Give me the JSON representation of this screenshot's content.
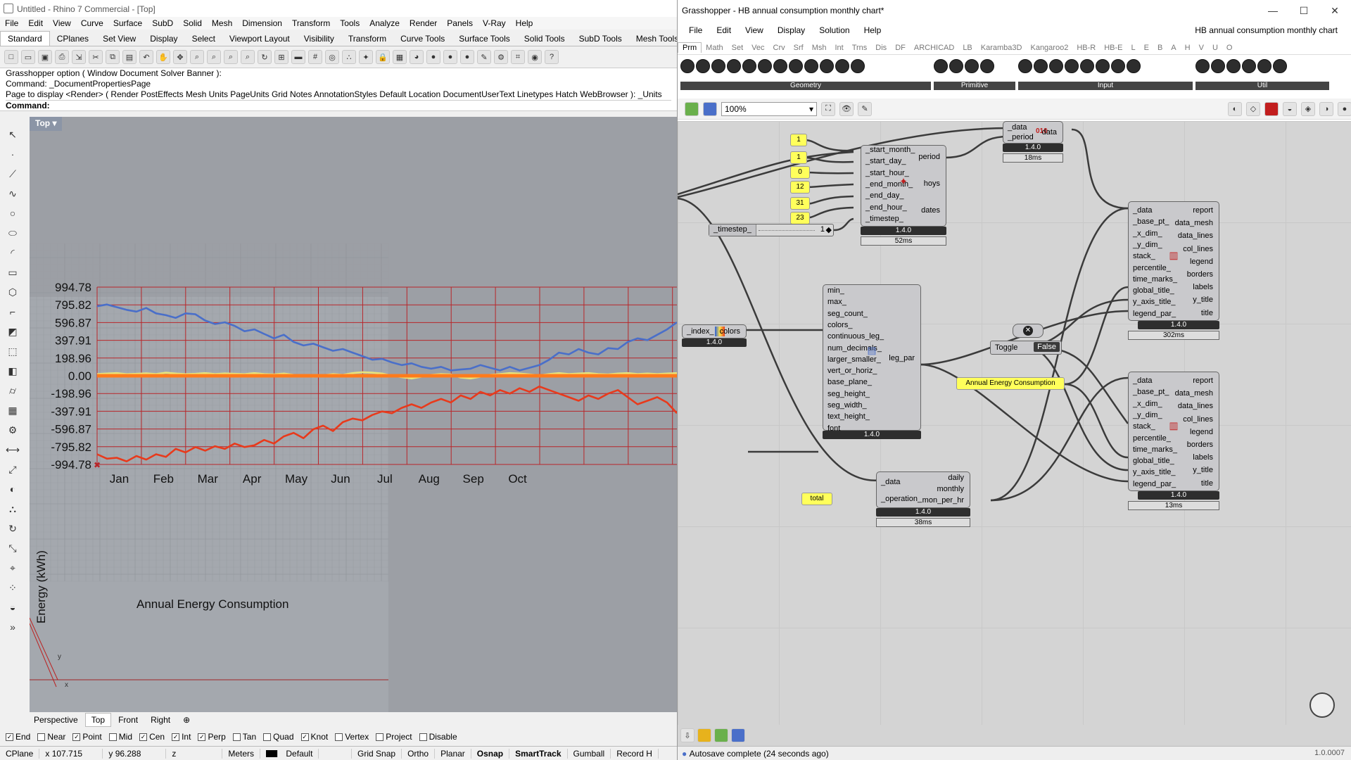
{
  "rhino": {
    "title": "Untitled - Rhino 7 Commercial - [Top]",
    "menu": [
      "File",
      "Edit",
      "View",
      "Curve",
      "Surface",
      "SubD",
      "Solid",
      "Mesh",
      "Dimension",
      "Transform",
      "Tools",
      "Analyze",
      "Render",
      "Panels",
      "V-Ray",
      "Help"
    ],
    "tabs": [
      "Standard",
      "CPlanes",
      "Set View",
      "Display",
      "Select",
      "Viewport Layout",
      "Visibility",
      "Transform",
      "Curve Tools",
      "Surface Tools",
      "Solid Tools",
      "SubD Tools",
      "Mesh Tools"
    ],
    "command_lines": [
      "Grasshopper option ( Window  Document  Solver  Banner ):",
      "Command: _DocumentPropertiesPage",
      "Page to display <Render> ( Render  PostEffects  Mesh  Units  PageUnits  Grid  Notes  AnnotationStyles  Default  Location  DocumentUserText  Linetypes  Hatch  WebBrowser ): _Units"
    ],
    "command_prompt": "Command:",
    "viewport_name": "Top",
    "view_tabs": [
      "Perspective",
      "Top",
      "Front",
      "Right"
    ],
    "osnaps": [
      {
        "label": "End",
        "checked": true
      },
      {
        "label": "Near",
        "checked": false
      },
      {
        "label": "Point",
        "checked": true
      },
      {
        "label": "Mid",
        "checked": false
      },
      {
        "label": "Cen",
        "checked": true
      },
      {
        "label": "Int",
        "checked": true
      },
      {
        "label": "Perp",
        "checked": true
      },
      {
        "label": "Tan",
        "checked": false
      },
      {
        "label": "Quad",
        "checked": false
      },
      {
        "label": "Knot",
        "checked": true
      },
      {
        "label": "Vertex",
        "checked": false
      },
      {
        "label": "Project",
        "checked": false
      },
      {
        "label": "Disable",
        "checked": false
      }
    ],
    "status": {
      "cplane": "CPlane",
      "x": "x 107.715",
      "y": "y 96.288",
      "z": "z",
      "units": "Meters",
      "layer": "Default",
      "toggles": [
        "Grid Snap",
        "Ortho",
        "Planar",
        "Osnap",
        "SmartTrack",
        "Gumball",
        "Record H"
      ]
    }
  },
  "chart_data": {
    "type": "line",
    "title": "Annual Energy Consumption",
    "ylabel": "Energy (kWh)",
    "xlabel": "",
    "categories": [
      "Jan",
      "Feb",
      "Mar",
      "Apr",
      "May",
      "Jun",
      "Jul",
      "Aug",
      "Sep",
      "Oct"
    ],
    "y_ticks": [
      "994.78",
      "795.82",
      "596.87",
      "397.91",
      "198.96",
      "0.00",
      "-198.96",
      "-397.91",
      "-596.87",
      "-795.82",
      "-994.78"
    ],
    "ylim": [
      -994.78,
      994.78
    ],
    "grid": true,
    "series": [
      {
        "color": "#4a6fc9",
        "values": [
          780,
          800,
          770,
          740,
          720,
          760,
          700,
          680,
          650,
          700,
          690,
          620,
          580,
          600,
          560,
          500,
          520,
          470,
          420,
          460,
          380,
          340,
          360,
          320,
          280,
          300,
          260,
          220,
          180,
          190,
          150,
          120,
          140,
          100,
          80,
          100,
          60,
          70,
          80,
          120,
          90,
          60,
          100,
          60,
          90,
          120,
          180,
          260,
          240,
          300,
          260,
          240,
          310,
          300,
          380,
          420,
          400,
          460,
          520,
          600
        ]
      },
      {
        "color": "#e8e37a",
        "values": [
          20,
          25,
          30,
          18,
          22,
          28,
          20,
          35,
          25,
          18,
          22,
          30,
          20,
          26,
          22,
          18,
          30,
          20,
          15,
          25,
          10,
          0,
          -10,
          5,
          20,
          10,
          30,
          40,
          35,
          25,
          0,
          -15,
          -30,
          -10,
          10,
          20,
          15,
          -20,
          -30,
          -10,
          10,
          20,
          30,
          25,
          15,
          5,
          20,
          30,
          20,
          25,
          30,
          20,
          15,
          25,
          30,
          20,
          25,
          20,
          25,
          30
        ]
      },
      {
        "color": "#ff7b1c",
        "values": [
          0,
          0,
          0,
          0,
          0,
          0,
          0,
          0,
          0,
          0,
          0,
          0,
          0,
          0,
          0,
          0,
          0,
          0,
          0,
          0,
          0,
          0,
          0,
          0,
          0,
          0,
          0,
          0,
          0,
          0,
          0,
          0,
          0,
          0,
          0,
          0,
          0,
          0,
          0,
          0,
          0,
          0,
          0,
          0,
          0,
          0,
          0,
          0,
          0,
          0,
          0,
          0,
          0,
          0,
          0,
          0,
          0,
          0,
          0,
          0
        ]
      },
      {
        "color": "#e83a1c",
        "values": [
          -880,
          -930,
          -920,
          -960,
          -900,
          -940,
          -880,
          -910,
          -820,
          -860,
          -800,
          -840,
          -790,
          -820,
          -760,
          -800,
          -780,
          -720,
          -760,
          -680,
          -640,
          -700,
          -600,
          -560,
          -620,
          -520,
          -480,
          -500,
          -440,
          -400,
          -420,
          -360,
          -320,
          -360,
          -300,
          -260,
          -300,
          -220,
          -260,
          -180,
          -220,
          -160,
          -200,
          -140,
          -180,
          -120,
          -160,
          -200,
          -240,
          -280,
          -220,
          -260,
          -200,
          -160,
          -240,
          -320,
          -280,
          -240,
          -300,
          -420
        ]
      }
    ]
  },
  "gh": {
    "title": "Grasshopper - HB annual consumption monthly chart*",
    "doc_name": "HB annual consumption monthly chart",
    "menu": [
      "File",
      "Edit",
      "View",
      "Display",
      "Solution",
      "Help"
    ],
    "tabs": [
      "Prm",
      "Math",
      "Set",
      "Vec",
      "Crv",
      "Srf",
      "Msh",
      "Int",
      "Trns",
      "Dis",
      "DF",
      "ARCHICAD",
      "LB",
      "Karamba3D",
      "Kangaroo2",
      "HB-R",
      "HB-E",
      "L",
      "E",
      "B",
      "A",
      "H",
      "V",
      "U",
      "O"
    ],
    "ribbon_groups": [
      "Geometry",
      "Primitive",
      "Input",
      "Util"
    ],
    "zoom": "100%",
    "components": {
      "period_comp": {
        "inputs": [
          "_data",
          "_period"
        ],
        "output": "data",
        "version": "1.4.0",
        "timing": "18ms"
      },
      "analysis_period": {
        "inputs": [
          "_start_month_",
          "_start_day_",
          "_start_hour_",
          "_end_month_",
          "_end_day_",
          "_end_hour_",
          "_timestep_"
        ],
        "outputs": [
          "period",
          "hoys",
          "dates"
        ],
        "version": "1.4.0",
        "timing": "52ms"
      },
      "monthly_chart_1": {
        "inputs": [
          "_data",
          "_base_pt_",
          "_x_dim_",
          "_y_dim_",
          "stack_",
          "percentile_",
          "time_marks_",
          "global_title_",
          "y_axis_title_",
          "legend_par_"
        ],
        "outputs": [
          "report",
          "data_mesh",
          "data_lines",
          "col_lines",
          "legend",
          "borders",
          "labels",
          "y_title",
          "title"
        ],
        "version": "1.4.0",
        "timing": "302ms"
      },
      "monthly_chart_2": {
        "inputs": [
          "_data",
          "_base_pt_",
          "_x_dim_",
          "_y_dim_",
          "stack_",
          "percentile_",
          "time_marks_",
          "global_title_",
          "y_axis_title_",
          "legend_par_"
        ],
        "outputs": [
          "report",
          "data_mesh",
          "data_lines",
          "col_lines",
          "legend",
          "borders",
          "labels",
          "y_title",
          "title"
        ],
        "version": "1.4.0",
        "timing": "13ms"
      },
      "legend_par": {
        "inputs": [
          "min_",
          "max_",
          "seg_count_",
          "colors_",
          "continuous_leg_",
          "num_decimals_",
          "larger_smaller_",
          "vert_or_horiz_",
          "base_plane_",
          "seg_height_",
          "seg_width_",
          "text_height_",
          "font_"
        ],
        "output": "leg_par",
        "version": "1.4.0"
      },
      "gradient": {
        "input": "_index_",
        "output": "colors",
        "version": "1.4.0"
      },
      "timestep_slider": {
        "label": "_timestep_",
        "value": "1"
      },
      "aggregate": {
        "inputs": [
          "_data",
          "_operation_"
        ],
        "outputs": [
          "daily",
          "monthly",
          "mon_per_hr"
        ],
        "version": "1.4.0",
        "timing": "38ms"
      },
      "toggle": {
        "label": "Toggle",
        "value": "False"
      }
    },
    "panels": [
      "1",
      "1",
      "0",
      "12",
      "31",
      "23"
    ],
    "text_panel": "Annual Energy Consumption",
    "total_panel": "total",
    "status": "Autosave complete (24 seconds ago)",
    "version": "1.0.0007"
  }
}
